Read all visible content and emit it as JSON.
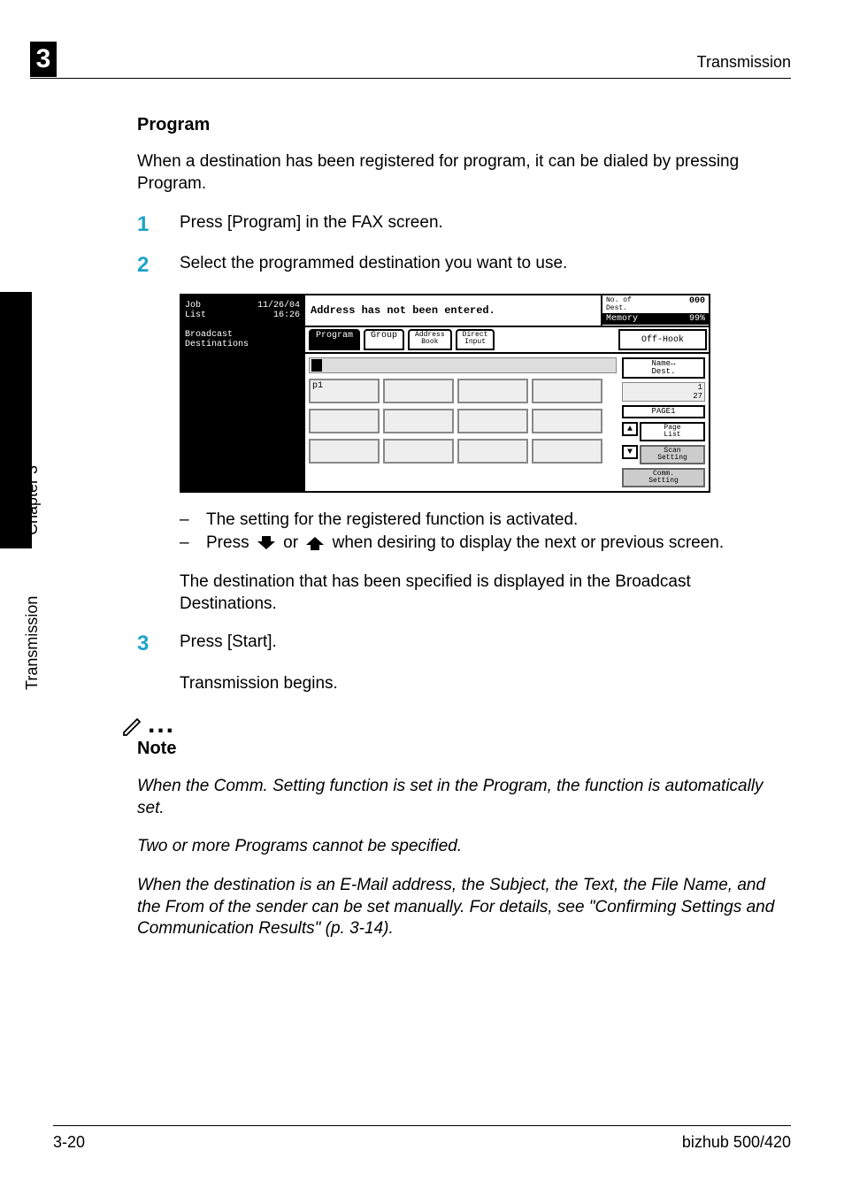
{
  "header": {
    "section_number": "3",
    "running_title": "Transmission"
  },
  "side": {
    "chapter": "Chapter 3",
    "section": "Transmission"
  },
  "content": {
    "h2": "Program",
    "intro": "When a destination has been registered for program, it can be dialed by pressing Program.",
    "step1_num": "1",
    "step1": "Press [Program] in the FAX screen.",
    "step2_num": "2",
    "step2": "Select the programmed destination you want to use.",
    "bullet1": "The setting for the registered function is activated.",
    "bullet2a": "Press ",
    "bullet2b": " or ",
    "bullet2c": " when desiring to display the next or previous screen.",
    "after_bullets": "The destination that has been specified is displayed in the Broadcast Destinations.",
    "step3_num": "3",
    "step3": "Press [Start].",
    "step3_after": "Transmission begins.",
    "note_label": "Note",
    "note1": "When the Comm. Setting function is set in the Program, the function is automatically set.",
    "note2": "Two or more Programs cannot be specified.",
    "note3": "When the destination is an E-Mail address, the Subject, the Text, the File Name, and the From of the sender can be set manually. For details, see \"Confirming Settings and Communication Results\" (p. 3-14)."
  },
  "lcd": {
    "job_list": "Job\nList",
    "datetime": "11/26/04\n16:26",
    "addr_msg": "Address has not been entered.",
    "dest_label": "No. of\nDest.",
    "dest_count": "000",
    "memory_label": "Memory",
    "memory_val": "99%",
    "broadcast": "Broadcast\nDestinations",
    "tab_program": "Program",
    "tab_group": "Group",
    "tab_address": "Address\nBook",
    "tab_direct": "Direct\nInput",
    "off_hook": "Off-Hook",
    "p1": "p1",
    "name_dest": "Name↔\nDest.",
    "page_counter": "1\n27",
    "page1": "PAGE1",
    "page_list": "Page\nList",
    "scan_setting": "Scan\nSetting",
    "comm_setting": "Comm.\nSetting"
  },
  "footer": {
    "left": "3-20",
    "right": "bizhub 500/420"
  }
}
